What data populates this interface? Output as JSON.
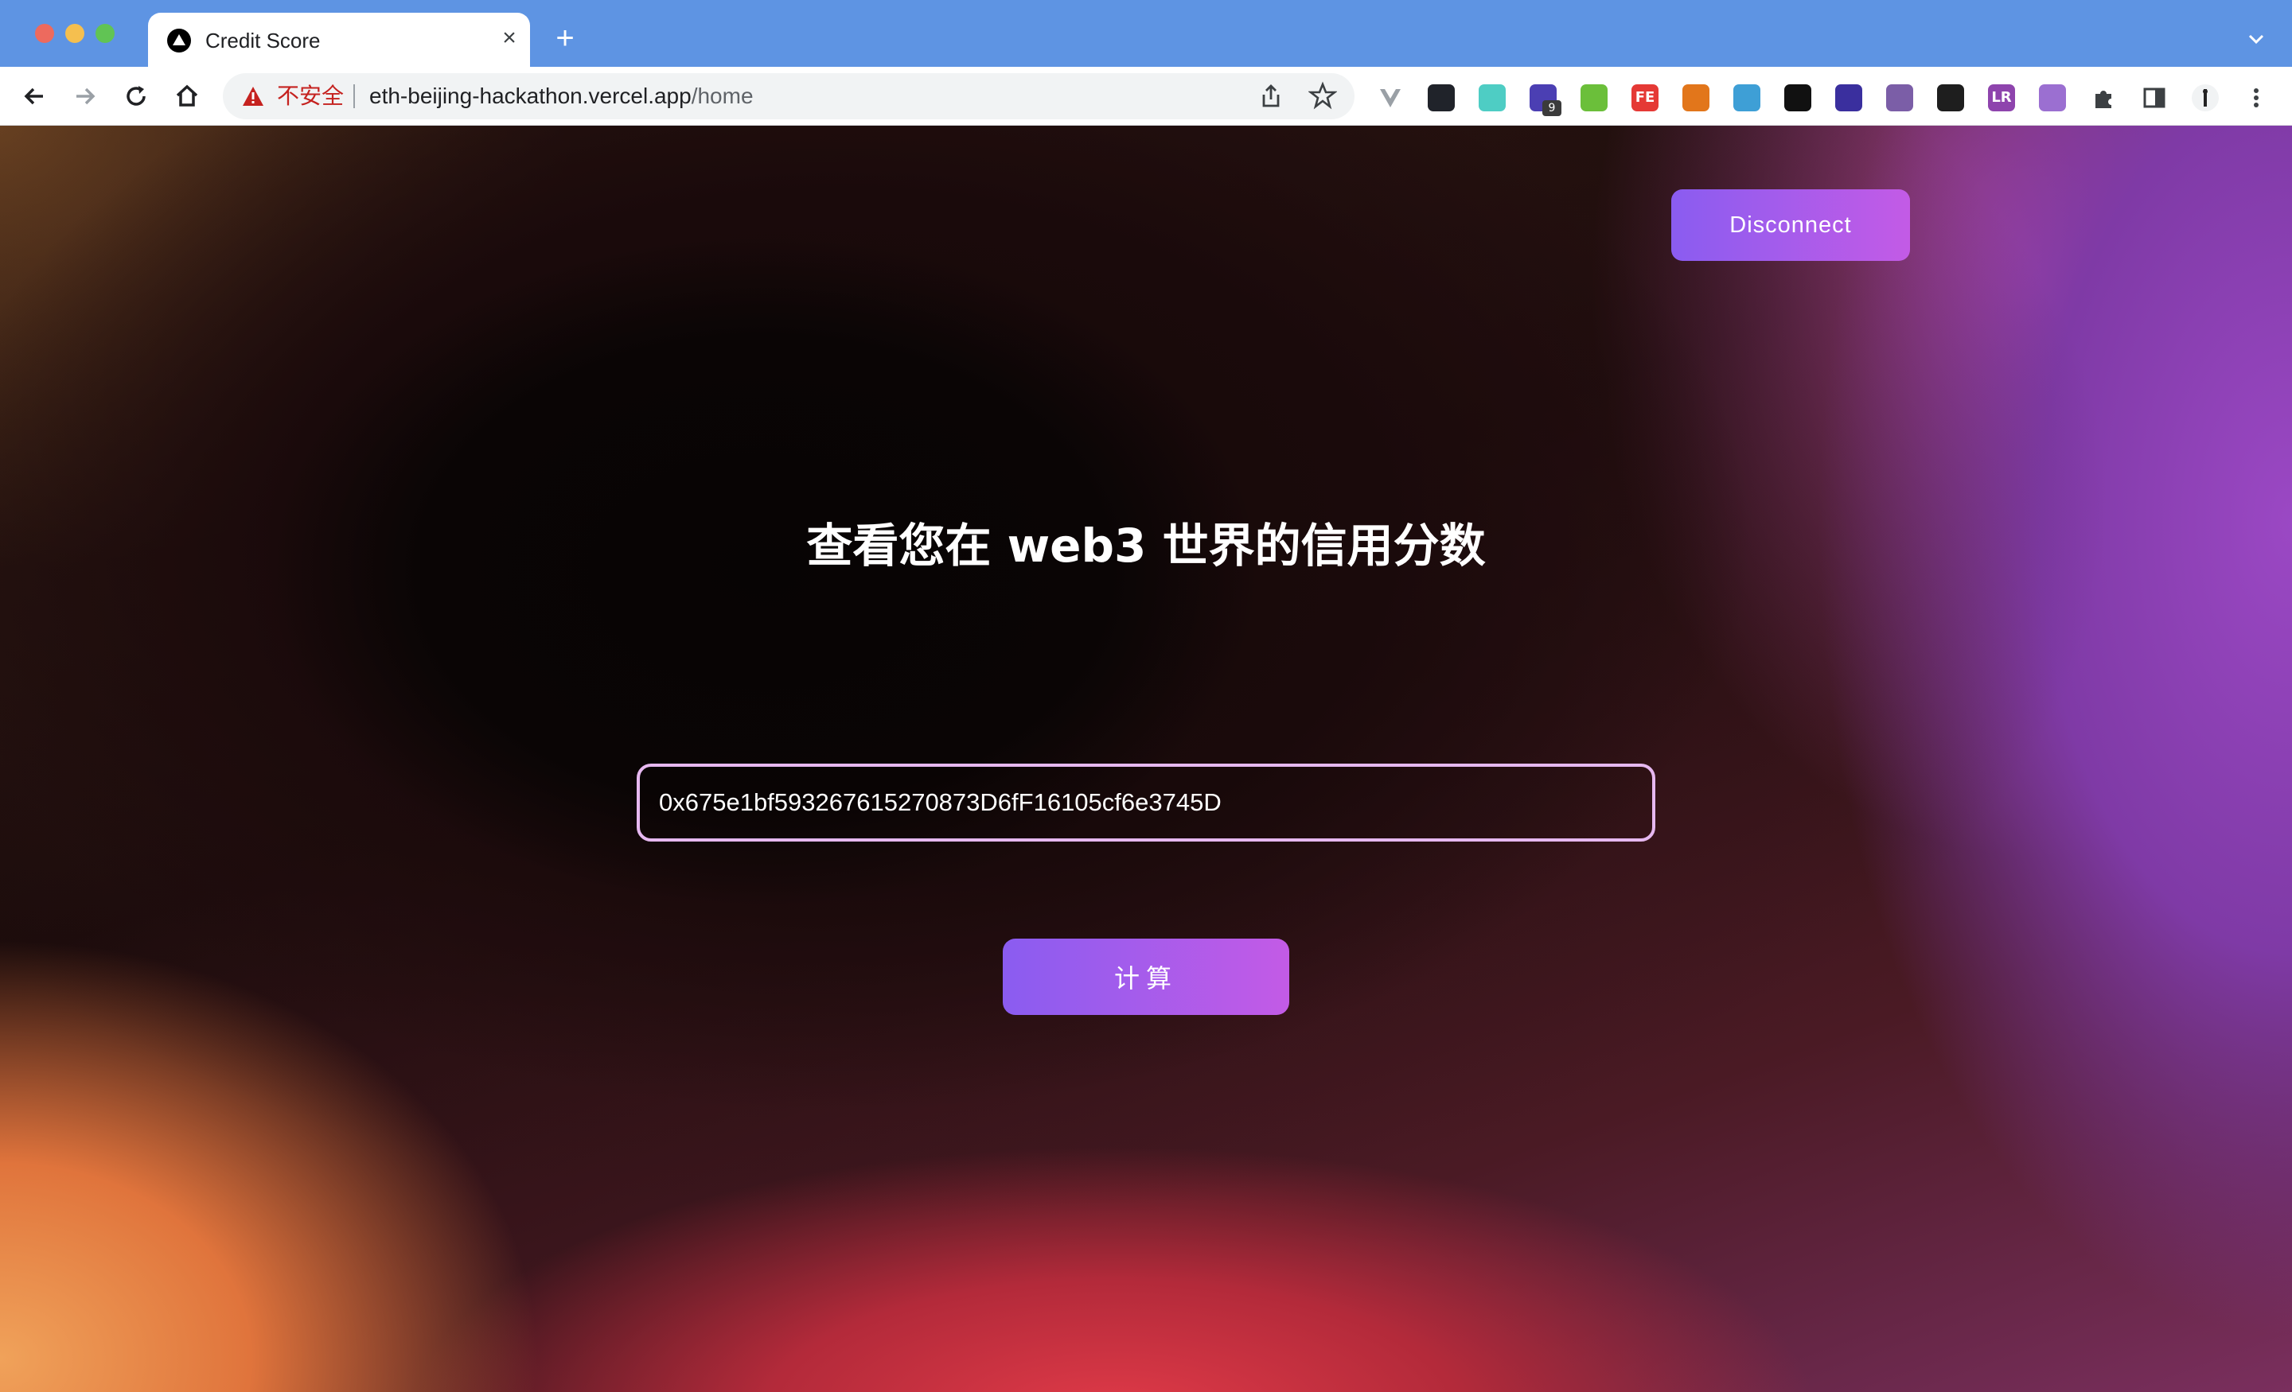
{
  "browser": {
    "tab": {
      "title": "Credit Score",
      "close_glyph": "×"
    },
    "new_tab_glyph": "+",
    "omnibox": {
      "security_label": "不安全",
      "host": "eth-beijing-hackathon.vercel.app",
      "path": "/home"
    },
    "extensions": [
      {
        "name": "vue-devtools-icon",
        "color": "#9aa0a6"
      },
      {
        "name": "react-devtools-icon",
        "color": "#20232a"
      },
      {
        "name": "extension-swirl-icon",
        "color": "#4ecdc4"
      },
      {
        "name": "extension-cube-icon",
        "color": "#4b3fb3",
        "badge": "9"
      },
      {
        "name": "extension-leaf-icon",
        "color": "#6bbf3a"
      },
      {
        "name": "extension-fe-icon",
        "color": "#e53935",
        "label": "FE"
      },
      {
        "name": "metamask-icon",
        "color": "#e2761b"
      },
      {
        "name": "extension-wallet-icon",
        "color": "#3e9fd6"
      },
      {
        "name": "extension-dark-icon",
        "color": "#111111"
      },
      {
        "name": "extension-chat-icon",
        "color": "#3a2f9e"
      },
      {
        "name": "openai-icon",
        "color": "#7b5ea7"
      },
      {
        "name": "binance-wallet-icon",
        "color": "#1e1e1e"
      },
      {
        "name": "extension-lr-icon",
        "color": "#8e44ad",
        "label": "LR"
      },
      {
        "name": "extension-orb-icon",
        "color": "#9b6fd1"
      },
      {
        "name": "extensions-puzzle-icon",
        "color": "#3c4043"
      },
      {
        "name": "side-panel-icon",
        "color": "#3c4043"
      },
      {
        "name": "profile-avatar-icon",
        "color": "#ffffff"
      },
      {
        "name": "menu-more-icon",
        "color": "#3c4043"
      }
    ]
  },
  "app": {
    "disconnect_label": "Disconnect",
    "heading": "查看您在 web3 世界的信用分数",
    "address_value": "0x675e1bf593267615270873D6fF16105cf6e3745D",
    "calculate_label": "计算"
  },
  "theme": {
    "accent_start": "#8a5cf0",
    "accent_end": "#c35be6",
    "input_border": "#e6b8f0"
  }
}
